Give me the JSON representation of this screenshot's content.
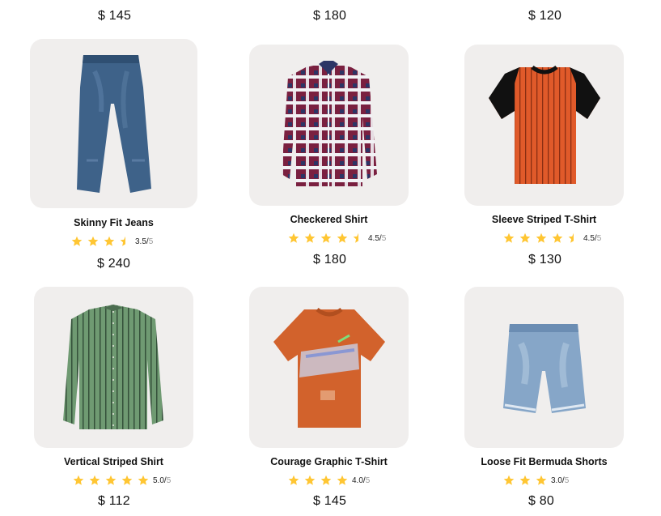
{
  "top_row": {
    "prices": [
      "$ 145",
      "$ 180",
      "$ 120"
    ]
  },
  "products": [
    {
      "name": "Skinny Fit Jeans",
      "rating": 3.5,
      "score": "3.5/",
      "denominator": "5",
      "price": "$ 240",
      "image_icon": "jeans-image"
    },
    {
      "name": "Checkered Shirt",
      "rating": 4.5,
      "score": "4.5/",
      "denominator": "5",
      "price": "$ 180",
      "image_icon": "checkered-shirt-image"
    },
    {
      "name": "Sleeve Striped T-Shirt",
      "rating": 4.5,
      "score": "4.5/",
      "denominator": "5",
      "price": "$ 130",
      "image_icon": "striped-tshirt-image"
    },
    {
      "name": "Vertical Striped Shirt",
      "rating": 5.0,
      "score": "5.0/",
      "denominator": "5",
      "price": "$ 112",
      "image_icon": "green-striped-shirt-image"
    },
    {
      "name": "Courage Graphic T-Shirt",
      "rating": 4.0,
      "score": "4.0/",
      "denominator": "5",
      "price": "$ 145",
      "image_icon": "graphic-tshirt-image"
    },
    {
      "name": "Loose Fit Bermuda Shorts",
      "rating": 3.0,
      "score": "3.0/",
      "denominator": "5",
      "price": "$ 80",
      "image_icon": "denim-shorts-image"
    }
  ],
  "colors": {
    "star": "#ffc633",
    "card_bg": "#f0eeed"
  }
}
